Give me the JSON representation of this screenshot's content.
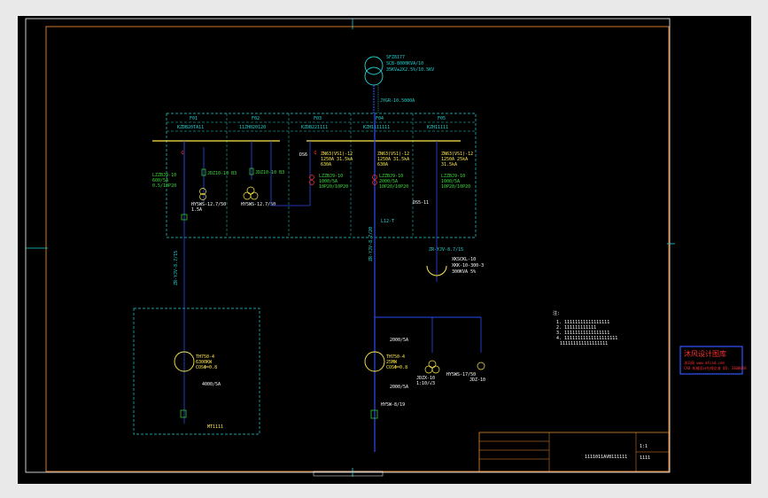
{
  "transformer": {
    "label1": "SFZ8177",
    "label2": "SCB-8000KVA/10",
    "label3": "35KV±2X2.5%/10.5KV"
  },
  "busbar_label": "JYGR-10.5000A",
  "feeders": [
    {
      "name": "F01",
      "code": "KZDB20TA11"
    },
    {
      "name": "F02",
      "code": "11ZH020120"
    },
    {
      "name": "F03",
      "code": "KZDB221111"
    },
    {
      "name": "F04",
      "code": "KZH1111111"
    },
    {
      "name": "F05",
      "code": "KZH11111"
    }
  ],
  "texts": {
    "f1_ct": "LZZBJ9-10",
    "f1_ct2": "600/5A",
    "f1_ct3": "0.5/10P20",
    "f1_pt": "JDZ10-10 B3",
    "f1_arr": "HY5WS-12.7/50",
    "f1_fuse": "1.5A",
    "f2_pt": "JDZ10-10 B3",
    "f2_arr": "HY5WS-12.7/50",
    "f3_label": "DS6",
    "f3_brk1": "ZN63(VS1)-12",
    "f3_brk2": "1250A 31.5kA",
    "f3_brk3": "630A",
    "f3_ct": "LZZBJ9-10",
    "f3_ct2": "1000/5A",
    "f3_ct3": "10P20/10P20",
    "f4_brk1": "ZN63(VS1)-12",
    "f4_brk2": "1250A 31.5kA",
    "f4_brk3": "630A",
    "f4_ct": "LZZBJ9-10",
    "f4_ct2": "2000/5A",
    "f4_ct3": "10P20/10P20",
    "f4_pt": "L12-T",
    "f5_brk1": "ZN63(VS1)-12",
    "f5_brk2": "1250A 25kA",
    "f5_brk3": "31.5kA",
    "f5_ct": "LZZBJ9-10",
    "f5_ct2": "1000/5A",
    "f5_ct3": "10P20/10P20",
    "f5_pt": "DS5-11",
    "cable1": "ZR-YJV-8.7/15",
    "cable2": "ZR-YJV-8.7/20",
    "cable3": "ZR-YJV-8.7/15",
    "reactor1": "XKSCKL-10",
    "reactor2": "300KVA 5%",
    "reactor3": "XKK-10-300-3",
    "gen1_a": "TH750-4",
    "gen1_b": "6300KW",
    "gen1_c": "COSΦ=0.8",
    "gen1_ct": "4000/5A",
    "gen1_label": "MT1111",
    "gen2_a": "TH750-4",
    "gen2_b": "25MW",
    "gen2_c": "COSΦ=0.8",
    "gen2_ct1": "2000/5A",
    "gen2_ct2": "2000/5A",
    "gen2_arr": "HY5W-8/19",
    "gen2_pt": "JDZX-10",
    "gen2_pt2": "1:10/√3",
    "gen2_lv": "HY5WS-17/50",
    "gen2_pt3": "JDZ-10",
    "notes_title": "注:",
    "note1": "1. 11111111111111111",
    "note2": "2. 111111111111",
    "note3": "3. 11111111111111111",
    "note4": "4. 11111111111111111111",
    "note5": "111111111111111111",
    "stamp1": "沐风设计图库",
    "stamp2": "沐风网 www.mfcad.com",
    "stamp3": "CAD 机械设计在线交流 QQ: 3300058",
    "title_text": "1111011AVB111111",
    "tb_a": "1:1",
    "tb_b": "1111"
  },
  "colors": {
    "frame_orange": "#e8862e",
    "white": "#ffffff",
    "cyan": "#22d3d3",
    "blue": "#2a4df0",
    "green": "#3ddc3d",
    "red": "#ff3030",
    "yellow": "#ffe94a",
    "stamp_blue": "#3355ff"
  }
}
